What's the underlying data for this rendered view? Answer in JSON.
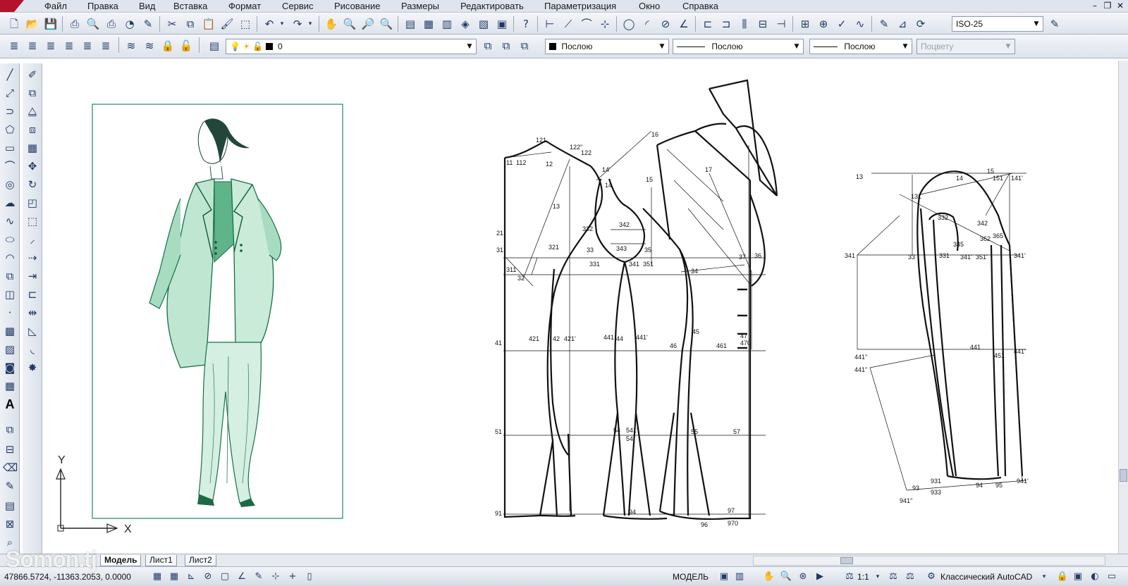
{
  "menu": [
    "Файл",
    "Правка",
    "Вид",
    "Вставка",
    "Формат",
    "Сервис",
    "Рисование",
    "Размеры",
    "Редактировать",
    "Параметризация",
    "Окно",
    "Справка"
  ],
  "toolbar": {
    "dimstyle": "ISO-25",
    "layer": "0",
    "color": "Послою",
    "linetype": "Послою",
    "lineweight": "Послою",
    "plotstyle": "Поцвету"
  },
  "drawing": {
    "axis_y": "Y",
    "axis_x": "X",
    "pattern_labels": {
      "back": [
        "121",
        "122\"",
        "122",
        "11",
        "112",
        "12",
        "13",
        "21",
        "31",
        "311",
        "32",
        "321",
        "41",
        "421",
        "42",
        "421'",
        "51",
        "91"
      ],
      "armhole": [
        "14'",
        "14",
        "15",
        "332",
        "342",
        "33",
        "343",
        "35",
        "331",
        "341",
        "351",
        "441",
        "44",
        "441'",
        "54",
        "541'",
        "54",
        "94"
      ],
      "front": [
        "16",
        "17",
        "34",
        "36",
        "37",
        "45",
        "46",
        "461",
        "47",
        "470",
        "55",
        "57",
        "96",
        "97",
        "970"
      ],
      "sleeve": [
        "13",
        "14",
        "15",
        "151",
        "141'",
        "131",
        "332",
        "342",
        "341",
        "331",
        "33",
        "341'",
        "345",
        "351'",
        "341'",
        "365",
        "362",
        "441''",
        "441''",
        "441",
        "451",
        "441'",
        "93",
        "931",
        "933",
        "94",
        "95",
        "941''",
        "941'"
      ]
    }
  },
  "tabs": [
    "Модель",
    "Лист1",
    "Лист2"
  ],
  "status": {
    "coords": "47866.5724, -11363.2053, 0.0000",
    "mode": "МОДЕЛЬ",
    "scale": "1:1",
    "workspace": "Классический AutoCAD"
  },
  "watermark": "Somon.tj",
  "colors": {
    "sketch_green": "#1e8a5c",
    "ui_bg": "#dfe5ee"
  }
}
